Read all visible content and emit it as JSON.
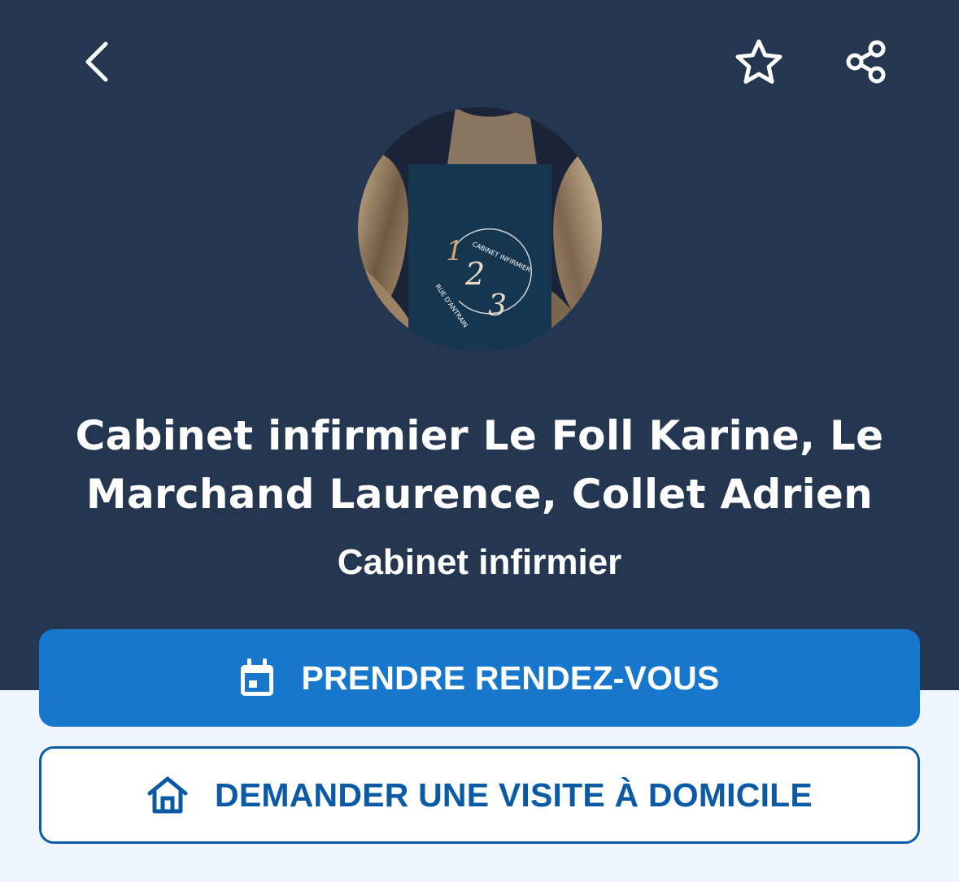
{
  "header": {
    "back_icon": "chevron-left-icon",
    "favorite_icon": "star-outline-icon",
    "share_icon": "share-icon"
  },
  "avatar": {
    "logo_number_1": "1",
    "logo_number_2": "2",
    "logo_number_3": "3",
    "logo_text_top": "CABINET INFIRMIER",
    "logo_text_bottom": "RUE D'ANTRAIN"
  },
  "profile": {
    "title": "Cabinet infirmier Le Foll Karine, Le Marchand Laurence, Collet Adrien",
    "subtitle": "Cabinet infirmier"
  },
  "actions": {
    "appointment_label": "PRENDRE RENDEZ-VOUS",
    "appointment_icon": "calendar-icon",
    "home_visit_label": "DEMANDER UNE VISITE À DOMICILE",
    "home_visit_icon": "home-icon"
  },
  "colors": {
    "header_bg": "#243650",
    "page_bg": "#eef5fc",
    "primary": "#1677cc",
    "secondary_text": "#0b5aa6"
  }
}
